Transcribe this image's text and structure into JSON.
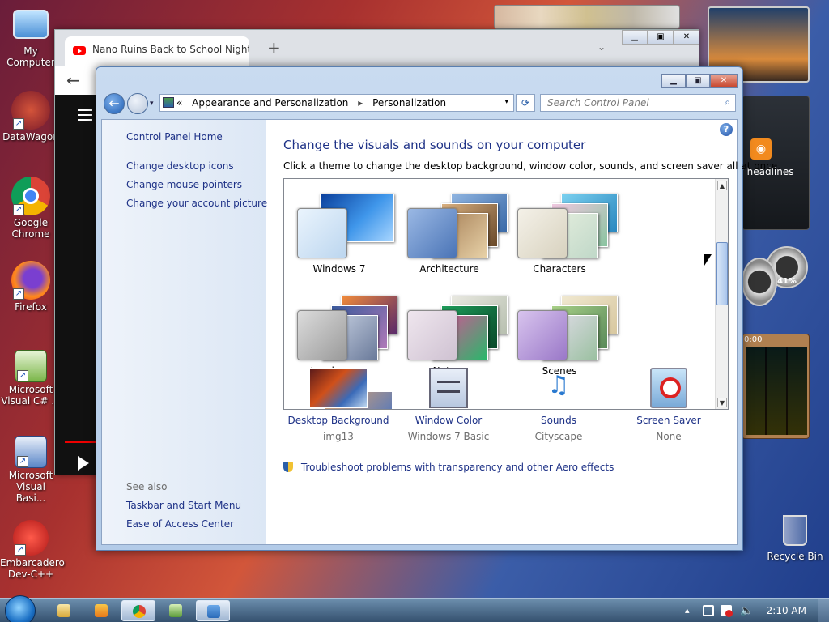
{
  "desktop": {
    "icons": [
      {
        "label": "My Computer",
        "icon": "computer-icon"
      },
      {
        "label": "DataWagon",
        "icon": "datawagon-icon"
      },
      {
        "label": "Google Chrome",
        "icon": "chrome-icon"
      },
      {
        "label": "Firefox",
        "icon": "firefox-icon"
      },
      {
        "label": "Microsoft Visual C# ...",
        "icon": "visual-csharp-icon"
      },
      {
        "label": "Microsoft Visual Basi...",
        "icon": "visual-basic-icon"
      },
      {
        "label": "Embarcadero Dev-C++",
        "icon": "devcpp-icon"
      }
    ],
    "recycle_bin": "Recycle Bin",
    "feed_gadget_text": "w headlines",
    "meter_text": "41%",
    "puzzle_time": "0:00"
  },
  "chrome": {
    "tab_title": "Nano Ruins Back to School Night",
    "new_tab": "+",
    "tab_dropdown": "⌄",
    "back": "←",
    "min": "▁",
    "max": "▣",
    "close": "✕"
  },
  "control_panel": {
    "caption_buttons": {
      "min": "▁",
      "max": "▣",
      "close": "✕"
    },
    "address": {
      "prefix": "«",
      "crumbs": [
        "Appearance and Personalization",
        "Personalization"
      ],
      "separator": "▸",
      "dropdown": "▾",
      "refresh": "⟳"
    },
    "search_placeholder": "Search Control Panel",
    "search_icon": "⌕",
    "help": "?",
    "sidebar": {
      "home": "Control Panel Home",
      "links": [
        "Change desktop icons",
        "Change mouse pointers",
        "Change your account picture"
      ],
      "see_also_title": "See also",
      "see_also": [
        "Taskbar and Start Menu",
        "Ease of Access Center"
      ]
    },
    "heading": "Change the visuals and sounds on your computer",
    "subheading": "Click a theme to change the desktop background, window color, sounds, and screen saver all at once.",
    "themes": [
      {
        "name": "Windows 7",
        "colors": [
          "#0e5ec8",
          "#5aa8ee"
        ],
        "glass": "#cfe3f6"
      },
      {
        "name": "Architecture",
        "colors": [
          "#5f86b8",
          "#c7a47a"
        ],
        "glass": "#6f93c6"
      },
      {
        "name": "Characters",
        "colors": [
          "#6fb8d8",
          "#e6c5d8"
        ],
        "glass": "#e6e2d4"
      },
      {
        "name": "Landscapes",
        "colors": [
          "#4e6fa6",
          "#e49a4a"
        ],
        "glass": "#bfbfbf"
      },
      {
        "name": "Nature",
        "colors": [
          "#1e8c4e",
          "#d94a8a"
        ],
        "glass": "#e4dce8"
      },
      {
        "name": "Scenes",
        "colors": [
          "#c3a3d6",
          "#8fb46a"
        ],
        "glass": "#b79bd8"
      }
    ],
    "scroll": {
      "up": "▲",
      "down": "▼"
    },
    "settings": [
      {
        "label": "Desktop Background",
        "value": "img13",
        "icon": "desktop-background-icon"
      },
      {
        "label": "Window Color",
        "value": "Windows 7 Basic",
        "icon": "window-color-icon"
      },
      {
        "label": "Sounds",
        "value": "Cityscape",
        "icon": "sounds-icon"
      },
      {
        "label": "Screen Saver",
        "value": "None",
        "icon": "screen-saver-icon"
      }
    ],
    "troubleshoot": "Troubleshoot problems with transparency and other Aero effects"
  },
  "taskbar": {
    "clock": "2:10 AM",
    "tray_up": "▴"
  }
}
